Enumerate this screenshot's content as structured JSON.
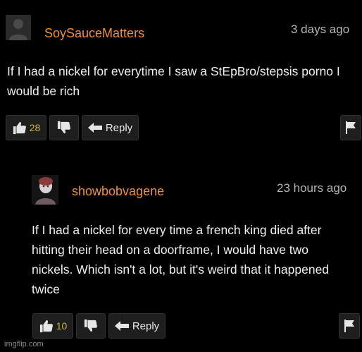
{
  "comments": [
    {
      "username": "SoySauceMatters",
      "timestamp": "3 days ago",
      "text": "If I had a nickel for everytime I saw a StEpBro/stepsis porno I would be rich",
      "likes": "28",
      "reply_label": "Reply",
      "avatar": "default-user-silhouette"
    },
    {
      "username": "showbobvagene",
      "timestamp": "23 hours ago",
      "text": "If I had a nickel for every time a french king died after hitting their head on a doorframe, I would have two nickels. Which isn't a lot, but it's weird that it happened twice",
      "likes": "10",
      "reply_label": "Reply",
      "avatar": "user-photo-avatar"
    }
  ],
  "icons": {
    "like": "thumbs-up-icon",
    "dislike": "thumbs-down-icon",
    "reply": "reply-arrow-icon",
    "flag": "flag-icon"
  },
  "colors": {
    "background": "#000000",
    "username": "#f0913b",
    "like_count": "#c8b43a"
  },
  "watermark": "imgflip.com"
}
